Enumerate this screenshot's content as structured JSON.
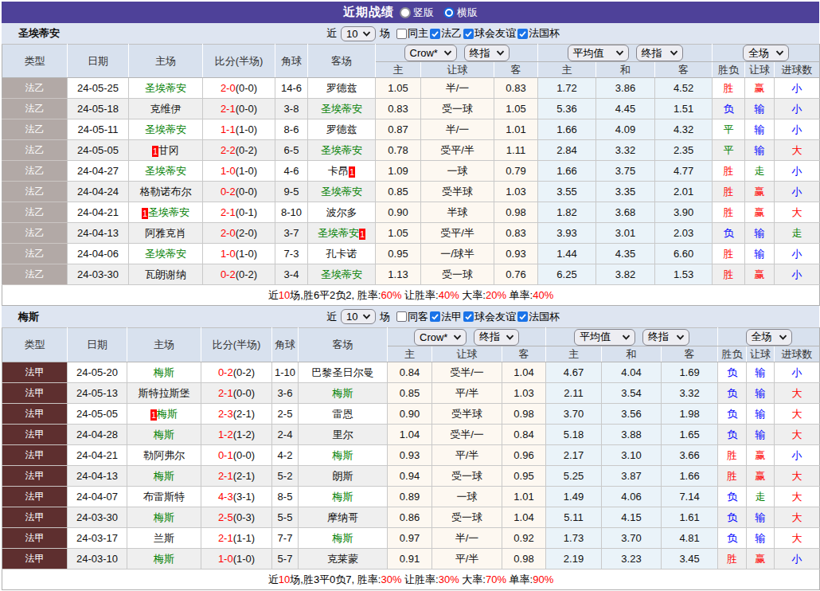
{
  "title_bar": {
    "title": "近期战绩",
    "radios": [
      {
        "label": "竖版",
        "selected": false
      },
      {
        "label": "横版",
        "selected": true
      }
    ]
  },
  "table_header": {
    "cols": [
      "类型",
      "日期",
      "主场",
      "比分(半场)",
      "角球",
      "客场"
    ],
    "sub": [
      "主",
      "让球",
      "客",
      "主",
      "和",
      "客",
      "胜负",
      "让球",
      "进球数"
    ],
    "select_groups": {
      "ah": [
        "Crow*",
        "终指"
      ],
      "eu": [
        "平均值",
        "终指"
      ],
      "full": [
        "全场"
      ]
    }
  },
  "theme": {
    "title_bar_bg": "#4e4199",
    "team_bar_bg": "#dee5f1",
    "header_cell_bg": "#d8e1ee",
    "highlight_team_color": "#008000",
    "score_color": "#ff0000",
    "badge_bg": "#ff0000",
    "ah_col_bg": "#fdf8f1",
    "eu_col_bg": "#eaf3f9",
    "checkbox_checked_bg": "#1a73e8",
    "radio_selected_color": "#1565dd"
  },
  "result_colors": {
    "胜": "#ff0000",
    "赢": "#ff0000",
    "大": "#ff0000",
    "负": "#0000ff",
    "输": "#0000ff",
    "小": "#0000ff",
    "平": "#008000",
    "走": "#008000"
  },
  "sections": [
    {
      "team": "圣埃蒂安",
      "league": "法乙",
      "league_color": "#b2a9a6",
      "filters": {
        "near": "近",
        "count": "10",
        "unit": "场",
        "same_label": "同主",
        "same_checked": false,
        "leagues": [
          "法乙",
          "球会友谊",
          "法国杯"
        ]
      },
      "rows": [
        {
          "date": "24-05-25",
          "home": "圣埃蒂安",
          "home_green": true,
          "home_badge": false,
          "score": "2-0",
          "half": "(0-0)",
          "corner": "14-6",
          "away": "罗德兹",
          "away_green": false,
          "away_badge": false,
          "ah": [
            "1.05",
            "半/一",
            "0.83"
          ],
          "eu": [
            "1.72",
            "3.86",
            "4.52"
          ],
          "res": [
            "胜",
            "赢",
            "小"
          ]
        },
        {
          "date": "24-05-18",
          "home": "克维伊",
          "home_green": false,
          "home_badge": false,
          "score": "2-1",
          "half": "(0-0)",
          "corner": "3-8",
          "away": "圣埃蒂安",
          "away_green": true,
          "away_badge": false,
          "ah": [
            "0.83",
            "受一球",
            "1.05"
          ],
          "eu": [
            "5.36",
            "4.45",
            "1.51"
          ],
          "res": [
            "负",
            "输",
            "小"
          ]
        },
        {
          "date": "24-05-11",
          "home": "圣埃蒂安",
          "home_green": true,
          "home_badge": false,
          "score": "1-1",
          "half": "(1-0)",
          "corner": "8-6",
          "away": "罗德兹",
          "away_green": false,
          "away_badge": false,
          "ah": [
            "0.87",
            "半/一",
            "1.01"
          ],
          "eu": [
            "1.66",
            "4.09",
            "4.32"
          ],
          "res": [
            "平",
            "输",
            "小"
          ]
        },
        {
          "date": "24-05-05",
          "home": "甘冈",
          "home_green": false,
          "home_badge": true,
          "score": "2-2",
          "half": "(0-2)",
          "corner": "6-5",
          "away": "圣埃蒂安",
          "away_green": true,
          "away_badge": false,
          "ah": [
            "0.78",
            "受平/半",
            "1.11"
          ],
          "eu": [
            "2.84",
            "3.32",
            "2.35"
          ],
          "res": [
            "平",
            "输",
            "大"
          ]
        },
        {
          "date": "24-04-27",
          "home": "圣埃蒂安",
          "home_green": true,
          "home_badge": false,
          "score": "1-0",
          "half": "(1-0)",
          "corner": "4-6",
          "away": "卡昂",
          "away_green": false,
          "away_badge": true,
          "ah": [
            "1.09",
            "一球",
            "0.79"
          ],
          "eu": [
            "1.66",
            "3.75",
            "4.77"
          ],
          "res": [
            "胜",
            "走",
            "小"
          ]
        },
        {
          "date": "24-04-24",
          "home": "格勒诺布尔",
          "home_green": false,
          "home_badge": false,
          "score": "0-2",
          "half": "(0-0)",
          "corner": "9-5",
          "away": "圣埃蒂安",
          "away_green": true,
          "away_badge": false,
          "ah": [
            "0.85",
            "受半球",
            "1.03"
          ],
          "eu": [
            "3.55",
            "3.35",
            "2.01"
          ],
          "res": [
            "胜",
            "赢",
            "小"
          ]
        },
        {
          "date": "24-04-21",
          "home": "圣埃蒂安",
          "home_green": true,
          "home_badge": true,
          "score": "2-1",
          "half": "(0-1)",
          "corner": "8-10",
          "away": "波尔多",
          "away_green": false,
          "away_badge": false,
          "ah": [
            "0.90",
            "半球",
            "0.98"
          ],
          "eu": [
            "1.82",
            "3.68",
            "3.90"
          ],
          "res": [
            "胜",
            "赢",
            "大"
          ]
        },
        {
          "date": "24-04-13",
          "home": "阿雅克肖",
          "home_green": false,
          "home_badge": false,
          "score": "2-0",
          "half": "(2-0)",
          "corner": "3-7",
          "away": "圣埃蒂安",
          "away_green": true,
          "away_badge": true,
          "ah": [
            "1.05",
            "受平/半",
            "0.83"
          ],
          "eu": [
            "3.93",
            "3.01",
            "2.03"
          ],
          "res": [
            "负",
            "输",
            "走"
          ]
        },
        {
          "date": "24-04-06",
          "home": "圣埃蒂安",
          "home_green": true,
          "home_badge": false,
          "score": "1-0",
          "half": "(1-0)",
          "corner": "7-3",
          "away": "孔卡诺",
          "away_green": false,
          "away_badge": false,
          "ah": [
            "0.95",
            "一/球半",
            "0.93"
          ],
          "eu": [
            "1.44",
            "4.35",
            "6.60"
          ],
          "res": [
            "胜",
            "输",
            "小"
          ]
        },
        {
          "date": "24-03-30",
          "home": "瓦朗谢纳",
          "home_green": false,
          "home_badge": false,
          "score": "0-2",
          "half": "(0-2)",
          "corner": "3-4",
          "away": "圣埃蒂安",
          "away_green": true,
          "away_badge": false,
          "ah": [
            "1.13",
            "受一球",
            "0.76"
          ],
          "eu": [
            "6.25",
            "3.82",
            "1.53"
          ],
          "res": [
            "胜",
            "赢",
            "小"
          ]
        }
      ],
      "summary_parts": [
        {
          "t": "近",
          "red": false
        },
        {
          "t": "10",
          "red": true
        },
        {
          "t": "场,胜6平2负2, 胜率:",
          "red": false
        },
        {
          "t": "60%",
          "red": true
        },
        {
          "t": " 让胜率:",
          "red": false
        },
        {
          "t": "40%",
          "red": true
        },
        {
          "t": " 大率:",
          "red": false
        },
        {
          "t": "20%",
          "red": true
        },
        {
          "t": " 单率:",
          "red": false
        },
        {
          "t": "40%",
          "red": true
        }
      ]
    },
    {
      "team": "梅斯",
      "league": "法甲",
      "league_color": "#5e2f2f",
      "filters": {
        "near": "近",
        "count": "10",
        "unit": "场",
        "same_label": "同客",
        "same_checked": false,
        "leagues": [
          "法甲",
          "球会友谊",
          "法国杯"
        ]
      },
      "rows": [
        {
          "date": "24-05-20",
          "home": "梅斯",
          "home_green": true,
          "home_badge": false,
          "score": "0-2",
          "half": "(0-2)",
          "corner": "1-10",
          "away": "巴黎圣日尔曼",
          "away_green": false,
          "away_badge": false,
          "ah": [
            "0.84",
            "受半/一",
            "1.04"
          ],
          "eu": [
            "4.67",
            "4.04",
            "1.69"
          ],
          "res": [
            "负",
            "输",
            "小"
          ]
        },
        {
          "date": "24-05-13",
          "home": "斯特拉斯堡",
          "home_green": false,
          "home_badge": false,
          "score": "2-1",
          "half": "(0-0)",
          "corner": "3-6",
          "away": "梅斯",
          "away_green": true,
          "away_badge": false,
          "ah": [
            "0.85",
            "平/半",
            "1.03"
          ],
          "eu": [
            "2.11",
            "3.54",
            "3.32"
          ],
          "res": [
            "负",
            "输",
            "大"
          ]
        },
        {
          "date": "24-05-05",
          "home": "梅斯",
          "home_green": true,
          "home_badge": true,
          "score": "2-3",
          "half": "(2-1)",
          "corner": "2-5",
          "away": "雷恩",
          "away_green": false,
          "away_badge": false,
          "ah": [
            "0.90",
            "受半球",
            "0.98"
          ],
          "eu": [
            "3.70",
            "3.56",
            "1.98"
          ],
          "res": [
            "负",
            "输",
            "大"
          ]
        },
        {
          "date": "24-04-28",
          "home": "梅斯",
          "home_green": true,
          "home_badge": false,
          "score": "1-2",
          "half": "(1-2)",
          "corner": "2-4",
          "away": "里尔",
          "away_green": false,
          "away_badge": false,
          "ah": [
            "1.04",
            "受半/一",
            "0.84"
          ],
          "eu": [
            "5.18",
            "3.88",
            "1.65"
          ],
          "res": [
            "负",
            "输",
            "大"
          ]
        },
        {
          "date": "24-04-21",
          "home": "勒阿弗尔",
          "home_green": false,
          "home_badge": false,
          "score": "0-1",
          "half": "(0-0)",
          "corner": "4-2",
          "away": "梅斯",
          "away_green": true,
          "away_badge": false,
          "ah": [
            "0.93",
            "平/半",
            "0.96"
          ],
          "eu": [
            "2.17",
            "3.10",
            "3.66"
          ],
          "res": [
            "胜",
            "赢",
            "小"
          ]
        },
        {
          "date": "24-04-13",
          "home": "梅斯",
          "home_green": true,
          "home_badge": false,
          "score": "2-1",
          "half": "(2-1)",
          "corner": "5-2",
          "away": "朗斯",
          "away_green": false,
          "away_badge": false,
          "ah": [
            "0.94",
            "受一球",
            "0.95"
          ],
          "eu": [
            "5.25",
            "3.87",
            "1.66"
          ],
          "res": [
            "胜",
            "赢",
            "大"
          ]
        },
        {
          "date": "24-04-07",
          "home": "布雷斯特",
          "home_green": false,
          "home_badge": false,
          "score": "4-3",
          "half": "(3-1)",
          "corner": "8-5",
          "away": "梅斯",
          "away_green": true,
          "away_badge": false,
          "ah": [
            "0.89",
            "一球",
            "1.01"
          ],
          "eu": [
            "1.49",
            "4.06",
            "7.14"
          ],
          "res": [
            "负",
            "走",
            "大"
          ]
        },
        {
          "date": "24-03-30",
          "home": "梅斯",
          "home_green": true,
          "home_badge": false,
          "score": "2-5",
          "half": "(0-3)",
          "corner": "5-5",
          "away": "摩纳哥",
          "away_green": false,
          "away_badge": false,
          "ah": [
            "0.86",
            "受一球",
            "1.04"
          ],
          "eu": [
            "5.11",
            "4.15",
            "1.61"
          ],
          "res": [
            "负",
            "输",
            "大"
          ]
        },
        {
          "date": "24-03-17",
          "home": "兰斯",
          "home_green": false,
          "home_badge": false,
          "score": "2-1",
          "half": "(1-1)",
          "corner": "7-7",
          "away": "梅斯",
          "away_green": true,
          "away_badge": false,
          "ah": [
            "0.97",
            "半/一",
            "0.92"
          ],
          "eu": [
            "1.73",
            "3.70",
            "4.81"
          ],
          "res": [
            "负",
            "输",
            "大"
          ]
        },
        {
          "date": "24-03-10",
          "home": "梅斯",
          "home_green": true,
          "home_badge": false,
          "score": "1-0",
          "half": "(1-0)",
          "corner": "5-7",
          "away": "克莱蒙",
          "away_green": false,
          "away_badge": false,
          "ah": [
            "0.91",
            "平/半",
            "0.98"
          ],
          "eu": [
            "2.19",
            "3.23",
            "3.45"
          ],
          "res": [
            "胜",
            "赢",
            "小"
          ]
        }
      ],
      "summary_parts": [
        {
          "t": "近",
          "red": false
        },
        {
          "t": "10",
          "red": true
        },
        {
          "t": "场,胜3平0负7, 胜率:",
          "red": false
        },
        {
          "t": "30%",
          "red": true
        },
        {
          "t": " 让胜率:",
          "red": false
        },
        {
          "t": "30%",
          "red": true
        },
        {
          "t": " 大率:",
          "red": false
        },
        {
          "t": "70%",
          "red": true
        },
        {
          "t": " 单率:",
          "red": false
        },
        {
          "t": "90%",
          "red": true
        }
      ]
    }
  ]
}
